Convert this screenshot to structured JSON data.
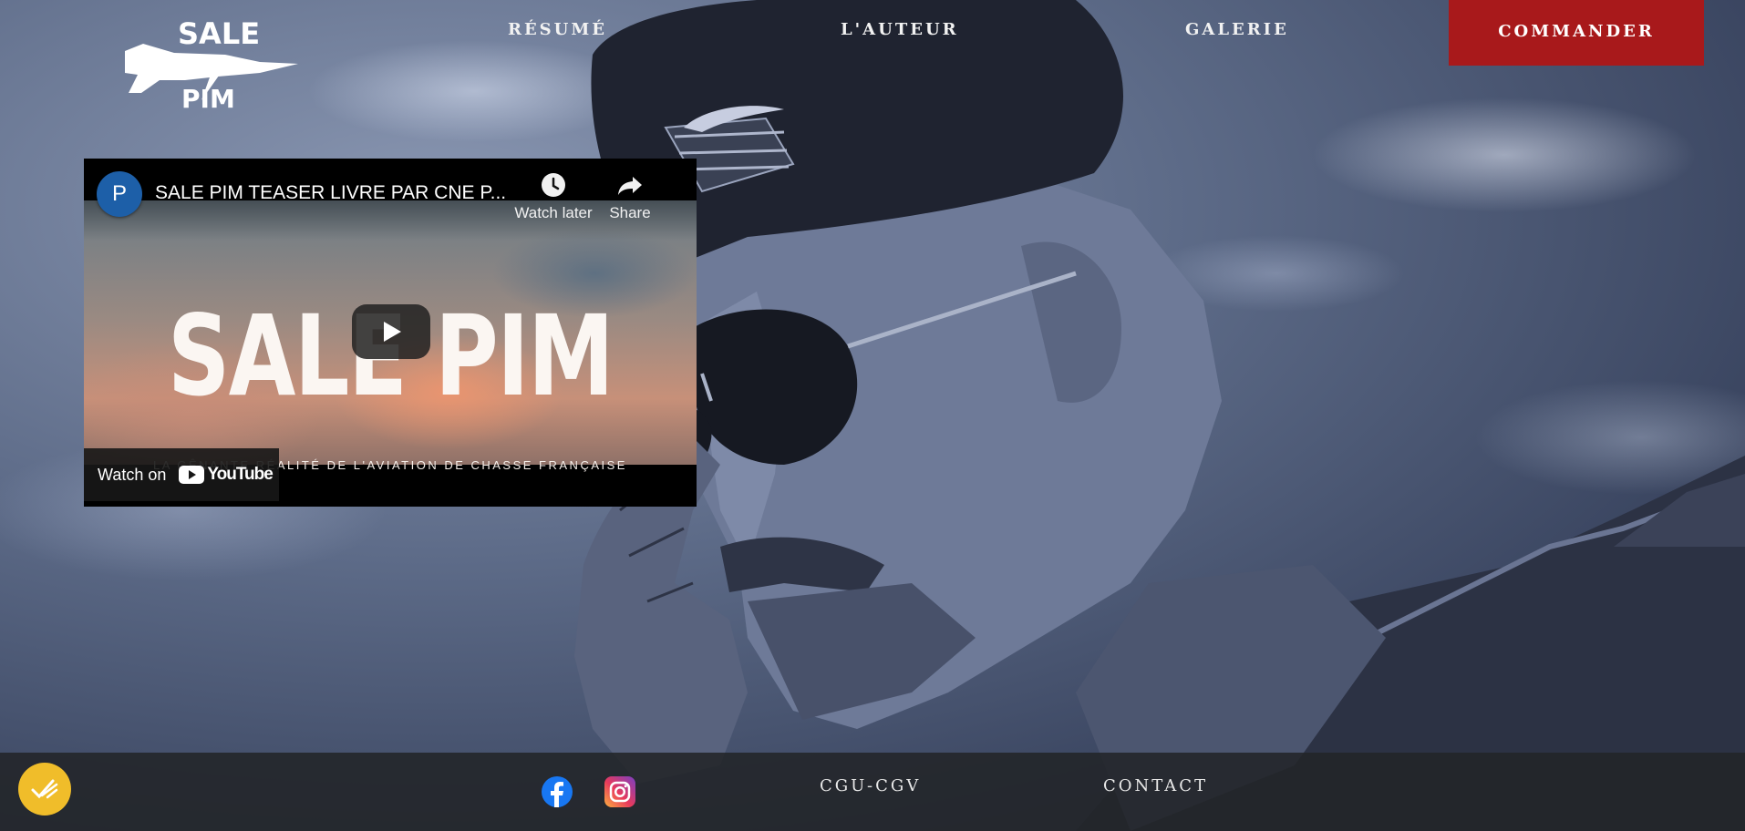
{
  "nav": {
    "logo_line1": "SALE",
    "logo_line2": "PIM",
    "links": [
      "RÉSUMÉ",
      "L'AUTEUR",
      "GALERIE"
    ],
    "order_label": "COMMANDER",
    "order_color": "#a8191b"
  },
  "video": {
    "channel_initial": "P",
    "title": "SALE PIM TEASER LIVRE PAR CNE P...",
    "watch_later_label": "Watch later",
    "share_label": "Share",
    "thumbnail_title": "SALE PIM",
    "thumbnail_subtitle": "LA GÊNANTE RÉALITÉ DE L'AVIATION DE CHASSE FRANÇAISE",
    "watch_on_label": "Watch on",
    "youtube_label": "YouTube"
  },
  "footer": {
    "links": [
      "CGU-CGV",
      "CONTACT"
    ],
    "social": [
      "facebook-icon",
      "instagram-icon"
    ],
    "fab_color": "#f0bd2a"
  }
}
